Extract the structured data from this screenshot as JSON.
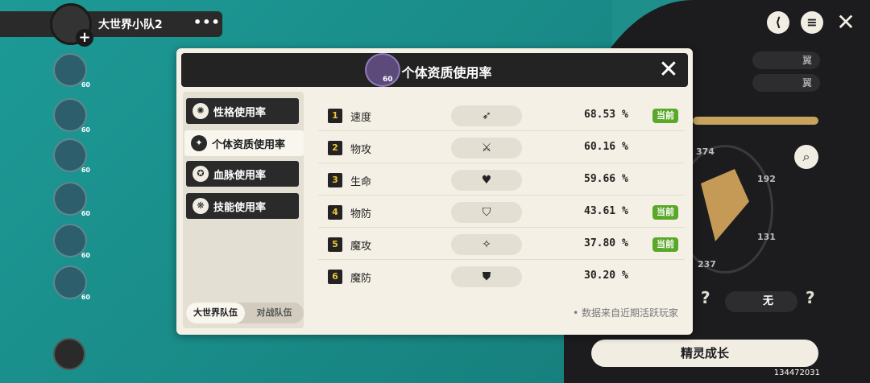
{
  "team": {
    "name": "大世界小队2",
    "more": "•••",
    "plus": "+"
  },
  "pets": [
    {
      "level": "60"
    },
    {
      "level": "60"
    },
    {
      "level": "60"
    },
    {
      "level": "60"
    },
    {
      "level": "60"
    },
    {
      "level": "60"
    }
  ],
  "top_icons": {
    "share": "⟨",
    "list": "≡",
    "close": "✕"
  },
  "attributes": [
    "翼",
    "翼"
  ],
  "stats_panel": {
    "top": "374",
    "right": "192",
    "right_lower": "131",
    "bottom_left": "237",
    "none_label": "无",
    "q1": "?",
    "q2": "?"
  },
  "growth_button": "精灵成长",
  "uid": "134472031",
  "dialog": {
    "title": "个体资质使用率",
    "pet_level": "60",
    "close": "✕",
    "tabs": [
      {
        "label": "性格使用率",
        "icon": "✺"
      },
      {
        "label": "个体资质使用率",
        "icon": "✦"
      },
      {
        "label": "血脉使用率",
        "icon": "✪"
      },
      {
        "label": "技能使用率",
        "icon": "❋"
      }
    ],
    "segments": [
      "大世界队伍",
      "对战队伍"
    ],
    "rows": [
      {
        "rank": "1",
        "name": "速度",
        "icon": "➶",
        "percent": "68.53 %",
        "badge": "当前"
      },
      {
        "rank": "2",
        "name": "物攻",
        "icon": "⚔",
        "percent": "60.16 %",
        "badge": ""
      },
      {
        "rank": "3",
        "name": "生命",
        "icon": "♥",
        "percent": "59.66 %",
        "badge": ""
      },
      {
        "rank": "4",
        "name": "物防",
        "icon": "⛉",
        "percent": "43.61 %",
        "badge": "当前"
      },
      {
        "rank": "5",
        "name": "魔攻",
        "icon": "✧",
        "percent": "37.80 %",
        "badge": "当前"
      },
      {
        "rank": "6",
        "name": "魔防",
        "icon": "⛊",
        "percent": "30.20 %",
        "badge": ""
      }
    ],
    "note": "• 数据来自近期活跃玩家"
  }
}
